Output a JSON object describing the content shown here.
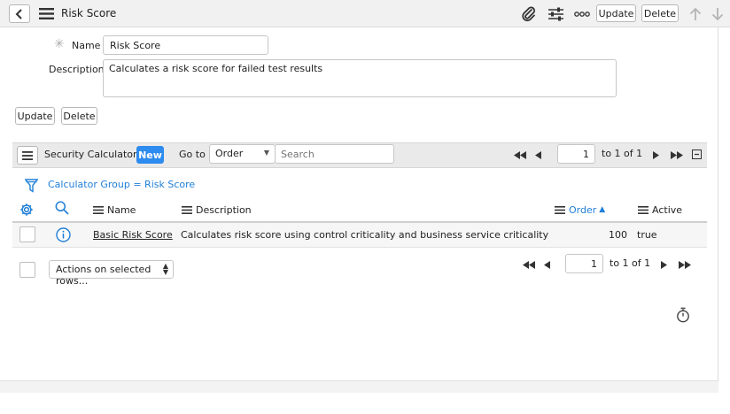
{
  "header": {
    "title": "Risk Score",
    "update_label": "Update",
    "delete_label": "Delete"
  },
  "form": {
    "name_label": "Name",
    "name_value": "Risk Score",
    "description_label": "Description",
    "description_value": "Calculates a risk score for failed test results",
    "update_label": "Update",
    "delete_label": "Delete"
  },
  "related_list": {
    "title": "Security Calculators",
    "new_label": "New",
    "goto_label": "Go to",
    "goto_field": "Order",
    "search_placeholder": "Search",
    "page_value": "1",
    "page_range": "to 1 of 1",
    "filter_text": "Calculator Group = Risk Score",
    "columns": {
      "name": "Name",
      "description": "Description",
      "order": "Order",
      "order_sort": "▲",
      "active": "Active"
    },
    "rows": [
      {
        "name": "Basic Risk Score",
        "description": "Calculates risk score using control criticality and business service criticality",
        "order": "100",
        "active": "true"
      }
    ],
    "actions_label": "Actions on selected rows...",
    "bottom_page_value": "1",
    "bottom_page_range": "to 1 of 1"
  },
  "colors": {
    "accent": "#1f7fd8",
    "new_button": "#2e8bef",
    "header_bg": "#f1f1f1",
    "list_header_bg": "#eaeaea"
  }
}
